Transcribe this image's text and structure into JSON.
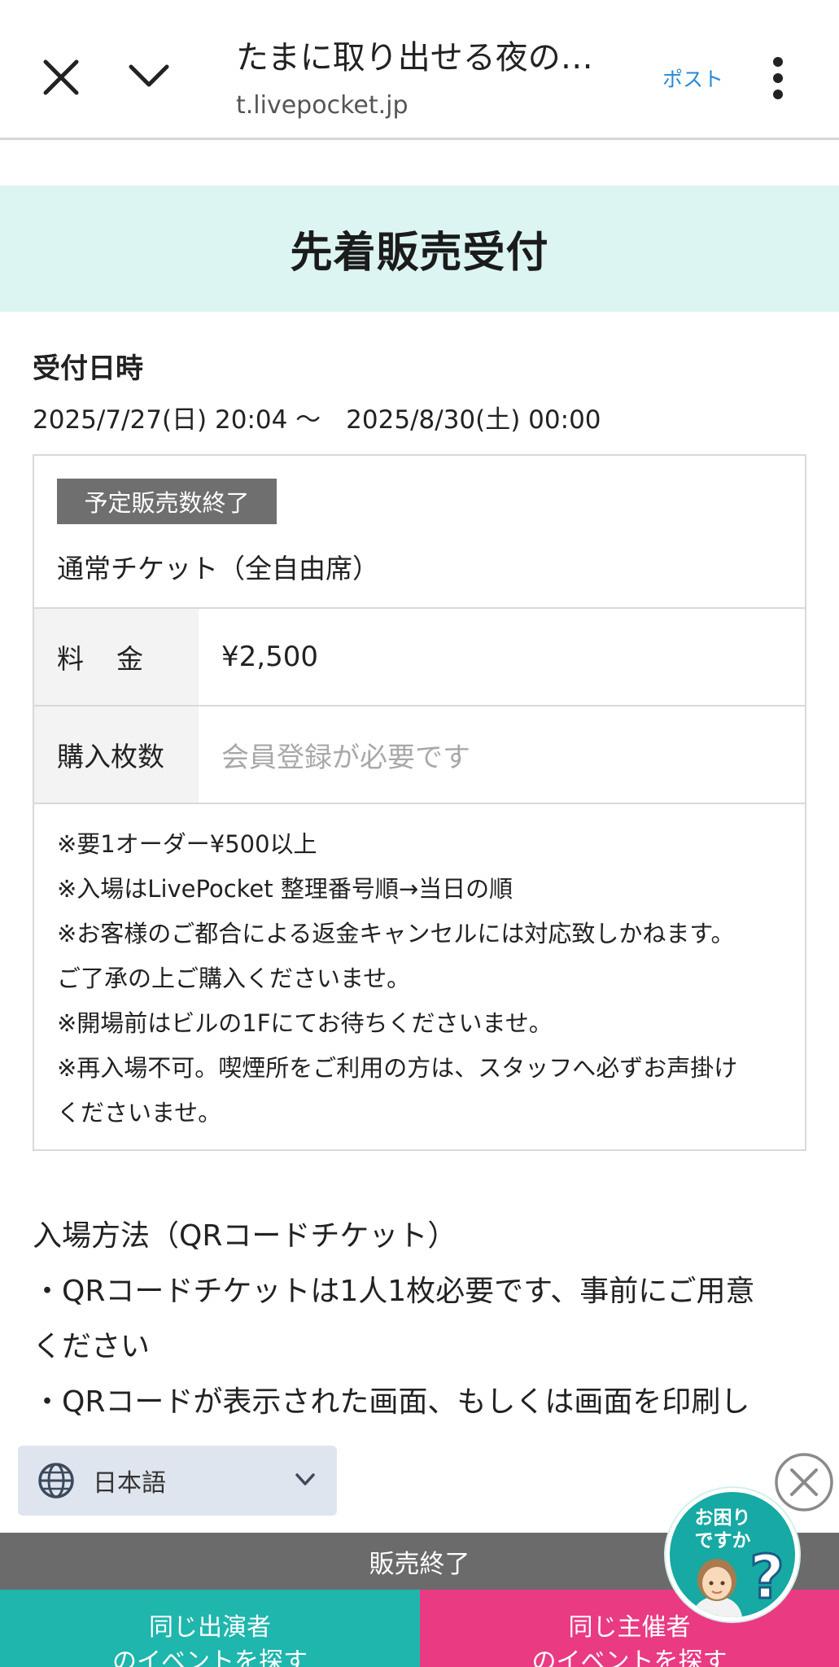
{
  "browser": {
    "title": "たまに取り出せる夜の…",
    "url": "t.livepocket.jp",
    "post_label": "ポスト"
  },
  "banner": {
    "title": "先着販売受付"
  },
  "reception": {
    "label": "受付日時",
    "range": "2025/7/27(日) 20:04 〜　2025/8/30(土) 00:00"
  },
  "ticket": {
    "badge": "予定販売数終了",
    "name": "通常チケット（全自由席）",
    "price_label": "料金",
    "price_value": "¥2,500",
    "qty_label": "購入枚数",
    "qty_value": "会員登録が必要です",
    "notes": [
      "※要1オーダー¥500以上",
      "※入場はLivePocket 整理番号順→当日の順",
      "※お客様のご都合による返金キャンセルには対応致しかねます。",
      "ご了承の上ご購入くださいませ。",
      "※開場前はビルの1Fにてお待ちくださいませ。",
      "※再入場不可。喫煙所をご利用の方は、スタッフへ必ずお声掛け",
      "くださいませ。"
    ]
  },
  "entry": {
    "lines": [
      "入場方法（QRコードチケット）",
      "・QRコードチケットは1人1枚必要です、事前にご用意",
      "ください",
      "・QRコードが表示された画面、もしくは画面を印刷し"
    ]
  },
  "language": {
    "selected": "日本語"
  },
  "help": {
    "text": "お困りですか"
  },
  "footer": {
    "soldout": "販売終了",
    "left_line1": "同じ出演者",
    "left_line2": "のイベントを探す",
    "right_line1": "同じ主催者",
    "right_line2": "のイベントを探す"
  },
  "colors": {
    "banner_bg": "#dcf4f2",
    "post_link": "#2a89d6",
    "soldout_bg": "#6b6b6b",
    "left_btn": "#1fb6ad",
    "right_btn": "#e93a82"
  },
  "icons": [
    "close-icon",
    "chevron-down-icon",
    "more-vertical-icon",
    "globe-icon",
    "caret-down-icon",
    "close-circle-icon",
    "help-question-icon"
  ]
}
